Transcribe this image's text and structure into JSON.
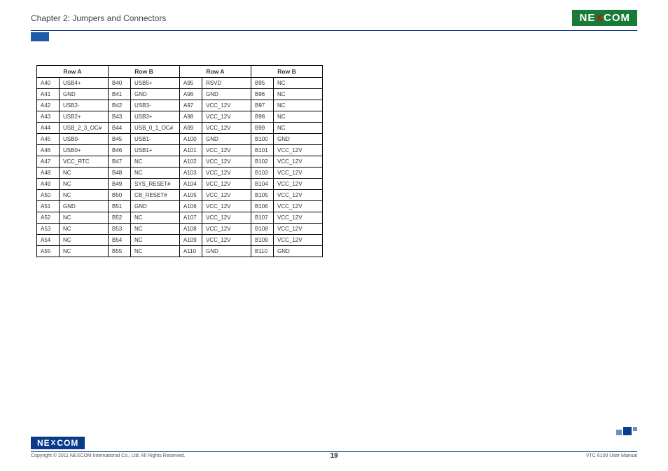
{
  "header": {
    "chapter": "Chapter 2: Jumpers and Connectors",
    "logo_left": "NE",
    "logo_x": "X",
    "logo_right": "COM"
  },
  "table": {
    "headers": [
      "Row A",
      "Row B",
      "Row A",
      "Row B"
    ],
    "rows": [
      [
        "A40",
        "USB4+",
        "B40",
        "USB5+",
        "A95",
        "RSVD",
        "B95",
        "NC"
      ],
      [
        "A41",
        "GND",
        "B41",
        "GND",
        "A96",
        "GND",
        "B96",
        "NC"
      ],
      [
        "A42",
        "USB2-",
        "B42",
        "USB3-",
        "A97",
        "VCC_12V",
        "B97",
        "NC"
      ],
      [
        "A43",
        "USB2+",
        "B43",
        "USB3+",
        "A98",
        "VCC_12V",
        "B98",
        "NC"
      ],
      [
        "A44",
        "USB_2_3_OC#",
        "B44",
        "USB_0_1_OC#",
        "A99",
        "VCC_12V",
        "B99",
        "NC"
      ],
      [
        "A45",
        "USB0-",
        "B45",
        "USB1-",
        "A100",
        "GND",
        "B100",
        "GND"
      ],
      [
        "A46",
        "USB0+",
        "B46",
        "USB1+",
        "A101",
        "VCC_12V",
        "B101",
        "VCC_12V"
      ],
      [
        "A47",
        "VCC_RTC",
        "B47",
        "NC",
        "A102",
        "VCC_12V",
        "B102",
        "VCC_12V"
      ],
      [
        "A48",
        "NC",
        "B48",
        "NC",
        "A103",
        "VCC_12V",
        "B103",
        "VCC_12V"
      ],
      [
        "A49",
        "NC",
        "B49",
        "SYS_RESET#",
        "A104",
        "VCC_12V",
        "B104",
        "VCC_12V"
      ],
      [
        "A50",
        "NC",
        "B50",
        "CB_RESET#",
        "A105",
        "VCC_12V",
        "B105",
        "VCC_12V"
      ],
      [
        "A51",
        "GND",
        "B51",
        "GND",
        "A106",
        "VCC_12V",
        "B106",
        "VCC_12V"
      ],
      [
        "A52",
        "NC",
        "B52",
        "NC",
        "A107",
        "VCC_12V",
        "B107",
        "VCC_12V"
      ],
      [
        "A53",
        "NC",
        "B53",
        "NC",
        "A108",
        "VCC_12V",
        "B108",
        "VCC_12V"
      ],
      [
        "A54",
        "NC",
        "B54",
        "NC",
        "A109",
        "VCC_12V",
        "B109",
        "VCC_12V"
      ],
      [
        "A55",
        "NC",
        "B55",
        "NC",
        "A110",
        "GND",
        "B110",
        "GND"
      ]
    ]
  },
  "footer": {
    "copyright": "Copyright © 2011 NEXCOM International Co., Ltd. All Rights Reserved.",
    "page": "19",
    "manual": "VTC 6100 User Manual"
  }
}
